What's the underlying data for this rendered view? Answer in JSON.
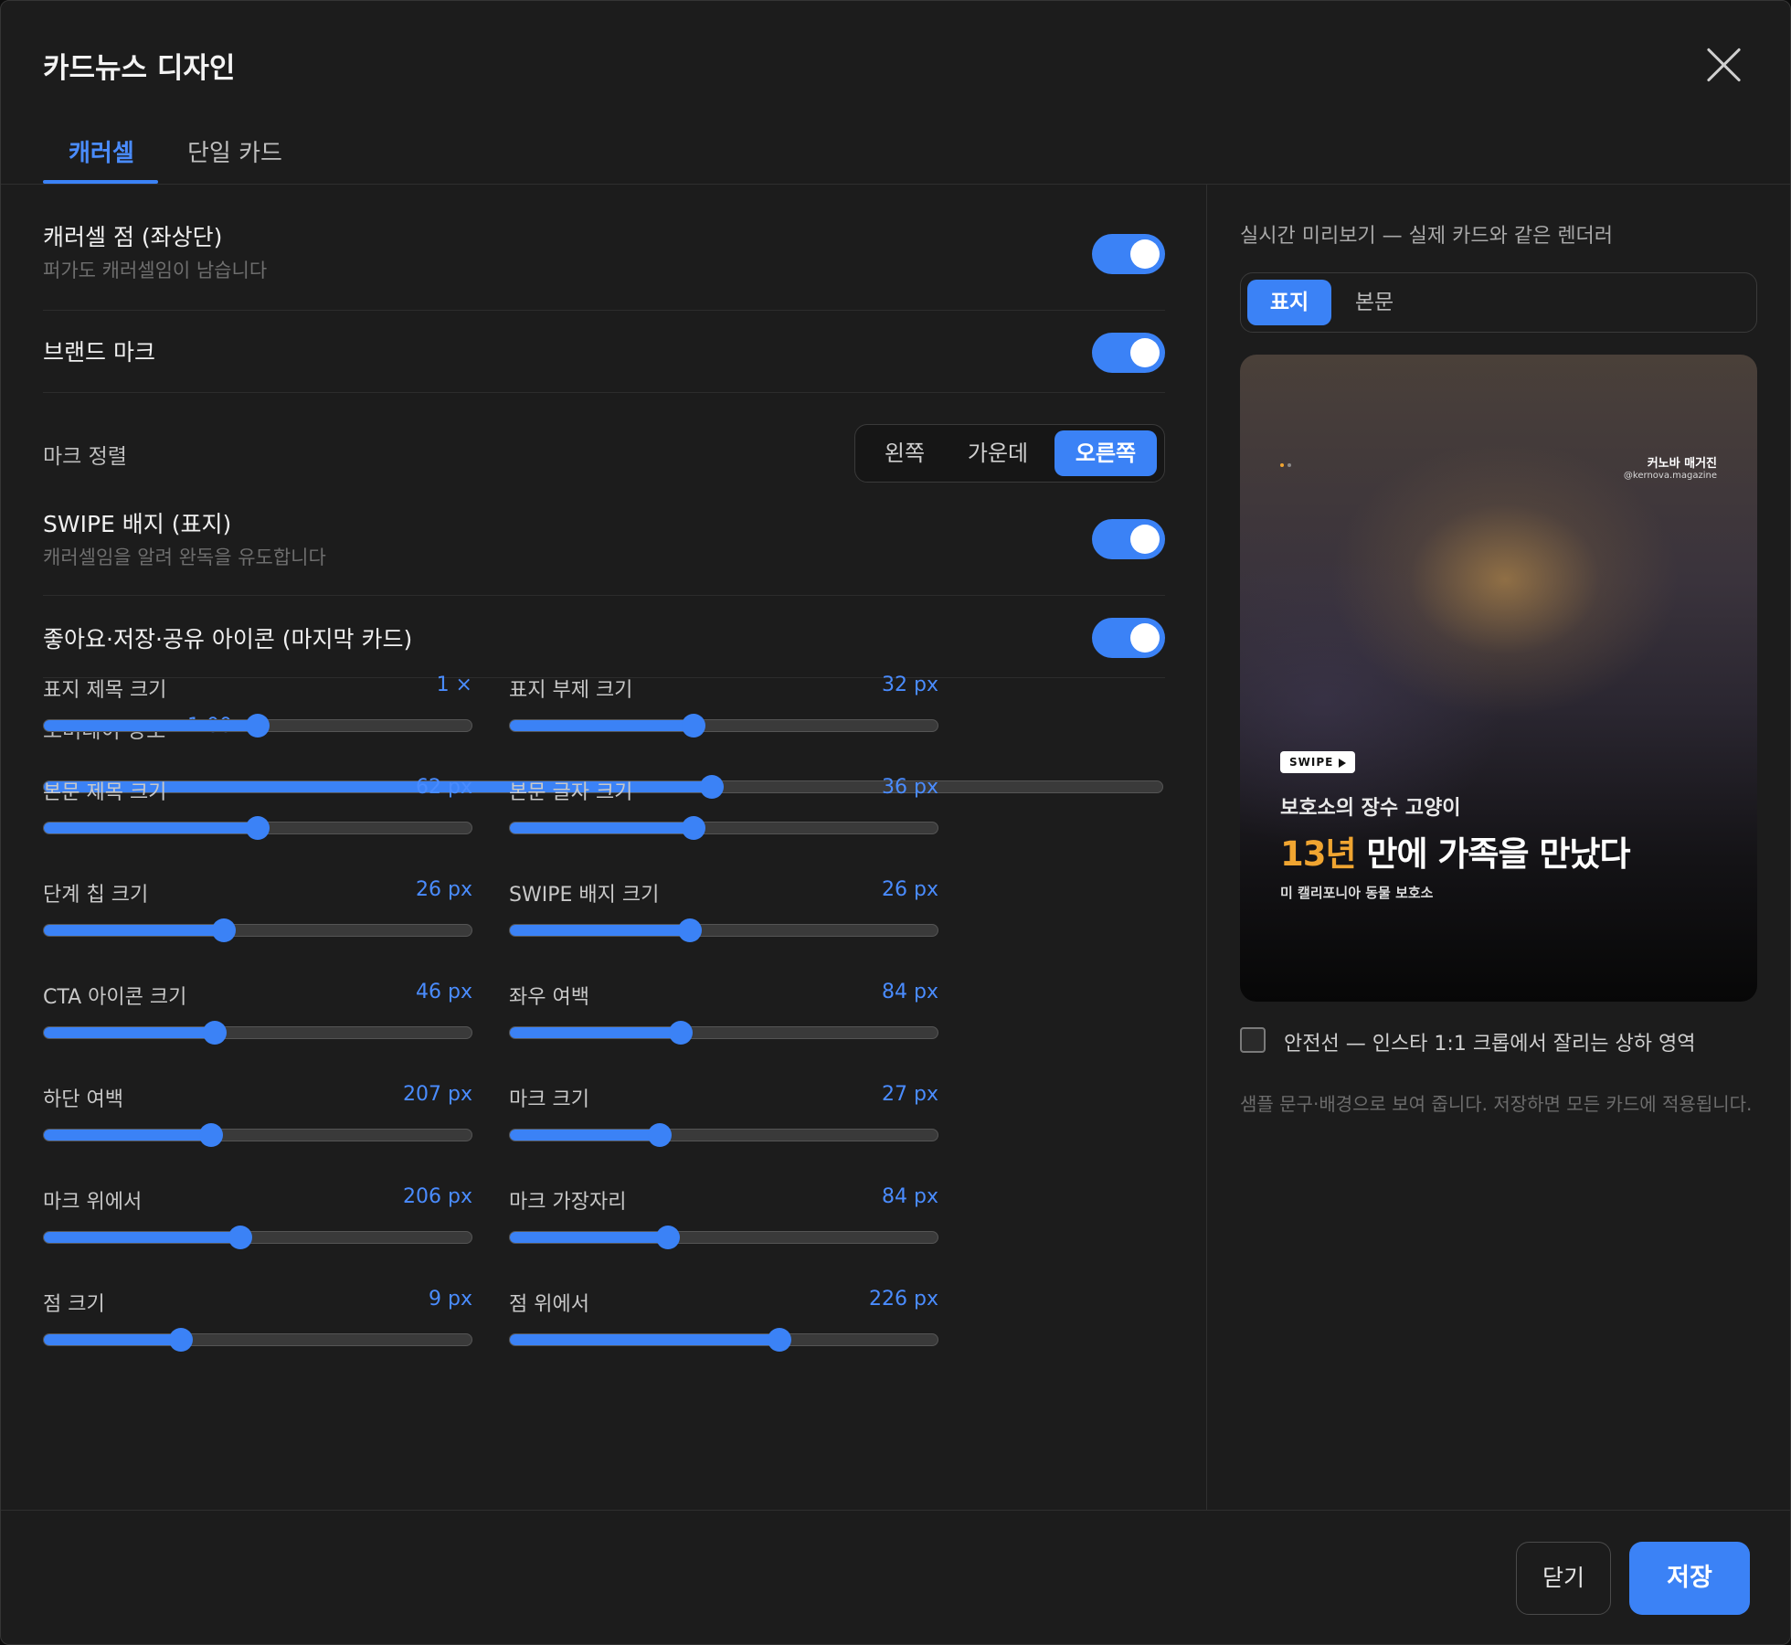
{
  "dialog": {
    "title": "카드뉴스 디자인"
  },
  "tabs": [
    {
      "label": "캐러셀",
      "active": true
    },
    {
      "label": "단일 카드",
      "active": false
    }
  ],
  "settings": {
    "carousel_dots": {
      "title": "캐러셀 점 (좌상단)",
      "subtitle": "퍼가도 캐러셀임이 남습니다",
      "on": true
    },
    "brand_mark": {
      "title": "브랜드 마크",
      "on": true
    },
    "mark_align": {
      "label": "마크 정렬",
      "options": [
        "왼쪽",
        "가운데",
        "오른쪽"
      ],
      "selected": "오른쪽"
    },
    "swipe_badge": {
      "title": "SWIPE 배지 (표지)",
      "subtitle": "캐러셀임을 알려 완독을 유도합니다",
      "on": true
    },
    "action_icons": {
      "title": "좋아요·저장·공유 아이콘 (마지막 카드)",
      "on": true
    },
    "overlay": {
      "label": "오버레이 강도",
      "value": "1.00",
      "fraction": 0.597
    }
  },
  "sliders": [
    {
      "label": "표지 제목 크기",
      "value": "1 ×",
      "fraction": 0.5
    },
    {
      "label": "표지 부제 크기",
      "value": "32 px",
      "fraction": 0.43
    },
    {
      "label": "본문 제목 크기",
      "value": "62 px",
      "fraction": 0.5
    },
    {
      "label": "본문 글자 크기",
      "value": "36 px",
      "fraction": 0.43
    },
    {
      "label": "단계 칩 크기",
      "value": "26 px",
      "fraction": 0.42
    },
    {
      "label": "SWIPE 배지 크기",
      "value": "26 px",
      "fraction": 0.42
    },
    {
      "label": "CTA 아이콘 크기",
      "value": "46 px",
      "fraction": 0.4
    },
    {
      "label": "좌우 여백",
      "value": "84 px",
      "fraction": 0.4
    },
    {
      "label": "하단 여백",
      "value": "207 px",
      "fraction": 0.39
    },
    {
      "label": "마크 크기",
      "value": "27 px",
      "fraction": 0.35
    },
    {
      "label": "마크 위에서",
      "value": "206 px",
      "fraction": 0.46
    },
    {
      "label": "마크 가장자리",
      "value": "84 px",
      "fraction": 0.37
    },
    {
      "label": "점 크기",
      "value": "9 px",
      "fraction": 0.32
    },
    {
      "label": "점 위에서",
      "value": "226 px",
      "fraction": 0.63
    }
  ],
  "preview": {
    "caption": "실시간 미리보기 — 실제 카드와 같은 렌더러",
    "tabs": [
      "표지",
      "본문"
    ],
    "selected_tab": "표지",
    "card": {
      "dot_colors": [
        "#f0a531",
        "#8a8a8a"
      ],
      "brand": "커노바 매거진",
      "handle": "@kernova.magazine",
      "swipe": "SWIPE",
      "subtitle": "보호소의 장수 고양이",
      "title_highlight": "13년",
      "title_rest": " 만에 가족을 만났다",
      "meta": "미 캘리포니아 동물 보호소",
      "highlight_color": "#f0a531"
    },
    "safe_line": {
      "label": "안전선 — 인스타 1:1 크롭에서 잘리는 상하 영역",
      "checked": false
    },
    "note": "샘플 문구·배경으로 보여 줍니다. 저장하면 모든 카드에 적용됩니다."
  },
  "footer": {
    "close_label": "닫기",
    "save_label": "저장"
  },
  "colors": {
    "accent": "#3b82f6",
    "background": "#1c1c1c",
    "highlight": "#f0a531"
  }
}
